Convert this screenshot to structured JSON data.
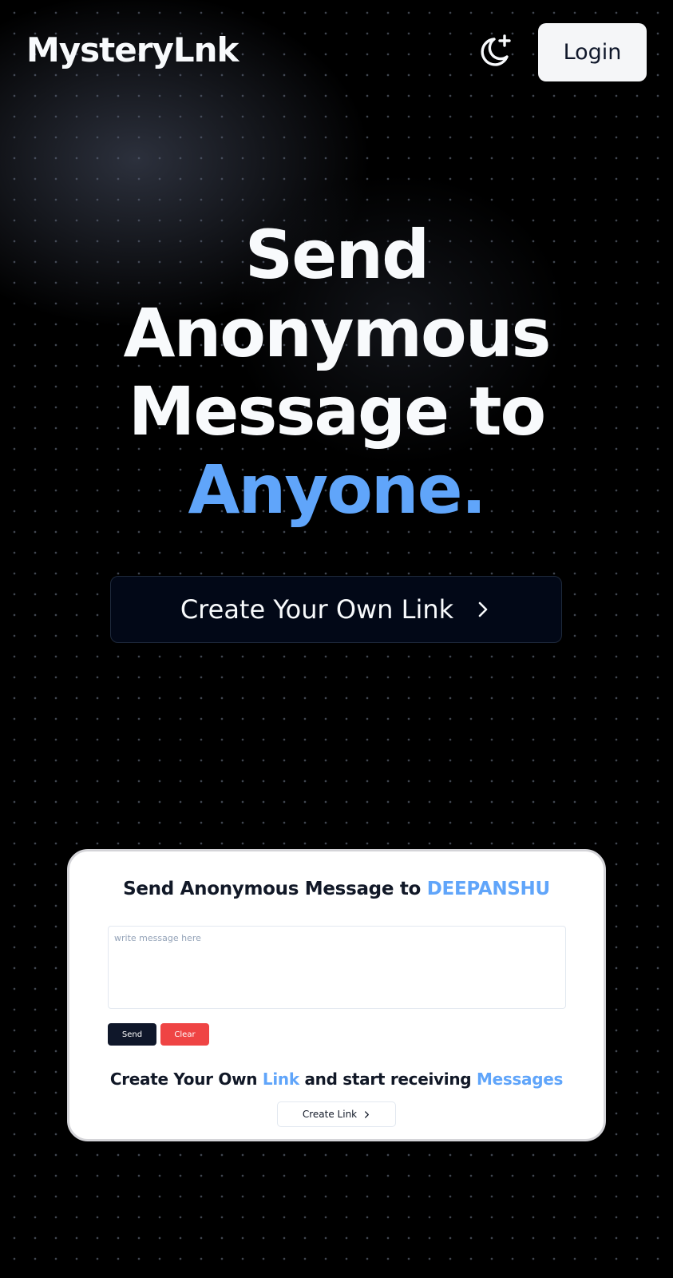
{
  "navbar": {
    "logo": "MysteryLnk",
    "theme_toggle_icon": "moon-plus-icon",
    "login_label": "Login"
  },
  "hero": {
    "line1": "Send",
    "line2": "Anonymous",
    "line3": "Message to",
    "line4_accent": "Anyone."
  },
  "cta": {
    "label": "Create Your Own Link",
    "icon": "chevron-right-icon"
  },
  "preview": {
    "title_prefix": "Send Anonymous Message to ",
    "title_name": "DEEPANSHU",
    "textarea_placeholder": "write message here",
    "send_label": "Send",
    "clear_label": "Clear",
    "sub_part1": "Create Your Own ",
    "sub_link": "Link",
    "sub_part2": " and start receiving ",
    "sub_messages": "Messages",
    "create_link_label": "Create Link"
  },
  "colors": {
    "background": "#000000",
    "accent": "#60a5fa",
    "login_bg": "#f5f6f8",
    "cta_bg": "#020817",
    "send_bg": "#0f172a",
    "clear_bg": "#ef4444"
  }
}
